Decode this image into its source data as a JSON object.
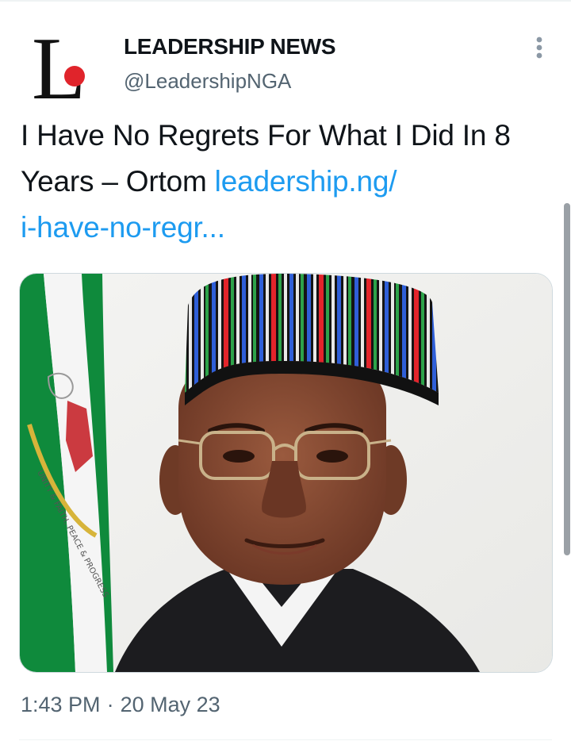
{
  "author": {
    "display_name": "LEADERSHIP NEWS",
    "handle": "@LeadershipNGA",
    "avatar_letter": "L",
    "avatar_dot_color": "#e0242b"
  },
  "tweet": {
    "text": "I Have No Regrets For What I Did In 8 Years – Ortom",
    "link_line1": "leadership.ng/",
    "link_line2": "i-have-no-regr...",
    "link_color": "#1d9bf0"
  },
  "media": {
    "flag_motto": "UNITY & FAITH, PEACE & PROGRESS"
  },
  "meta": {
    "time": "1:43 PM",
    "separator": "·",
    "date": "20 May 23"
  }
}
